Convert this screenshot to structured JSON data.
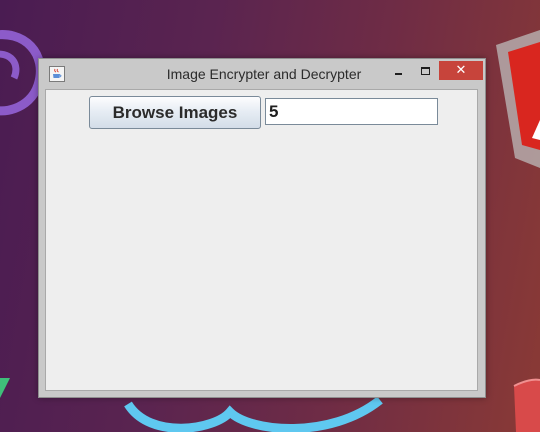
{
  "window": {
    "title": "Image Encrypter and Decrypter",
    "close_glyph": "✕"
  },
  "toolbar": {
    "browse_label": "Browse Images",
    "key_value": "5"
  },
  "icons": {
    "app": "java-cup-icon",
    "minimize": "minimize-icon",
    "maximize": "maximize-icon",
    "close": "close-icon"
  },
  "colors": {
    "close_button": "#c7443b",
    "window_frame": "#c9c9c9",
    "content_bg": "#eeeeee"
  }
}
